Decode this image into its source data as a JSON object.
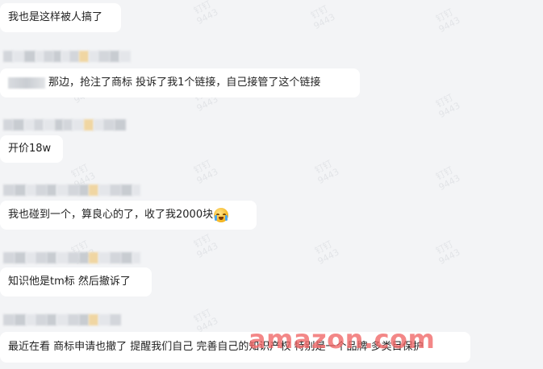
{
  "messages": [
    {
      "text": "我也是这样被人搞了"
    },
    {
      "text_after_mask": "那边，抢注了商标  投诉了我1个链接，自己接管了这个链接"
    },
    {
      "text": "开价18w"
    },
    {
      "text": "我也碰到一个，算良心的了，收了我2000块",
      "emoji": "crying-laughing-emoji"
    },
    {
      "text": "知识他是tm标  然后撤诉了"
    },
    {
      "text": "最近在看  商标申请也撤了 提醒我们自己 完善自己的知识产权 特别是一个品牌 多类目保护"
    }
  ],
  "watermark": {
    "line1": "钉钉",
    "line2": "9443"
  },
  "site_watermark": "amazon.com"
}
